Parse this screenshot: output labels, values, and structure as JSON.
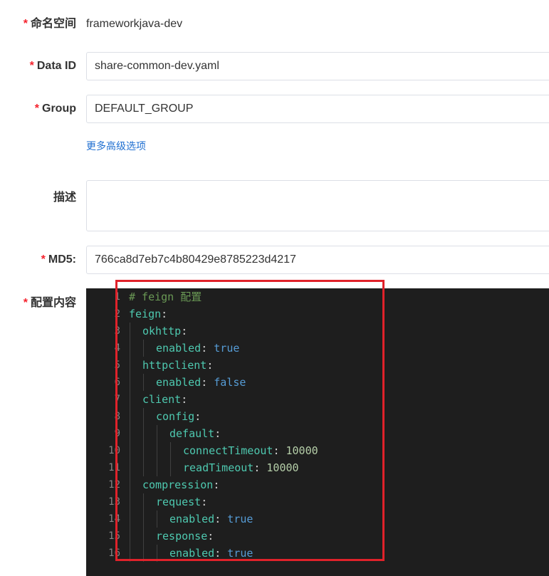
{
  "form": {
    "namespace": {
      "required": "*",
      "label": "命名空间",
      "value": "frameworkjava-dev"
    },
    "data_id": {
      "required": "*",
      "label": "Data ID",
      "value": "share-common-dev.yaml"
    },
    "group": {
      "required": "*",
      "label": "Group",
      "value": "DEFAULT_GROUP"
    },
    "advanced_link": "更多高级选项",
    "description": {
      "label": "描述",
      "value": ""
    },
    "md5": {
      "required": "*",
      "label": "MD5:",
      "value": "766ca8d7eb7c4b80429e8785223d4217"
    },
    "content": {
      "required": "*",
      "label": "配置内容"
    }
  },
  "editor": {
    "lines": [
      {
        "n": "1",
        "indent": 0,
        "comment": "# feign 配置"
      },
      {
        "n": "2",
        "indent": 0,
        "key": "feign"
      },
      {
        "n": "3",
        "indent": 1,
        "key": "okhttp"
      },
      {
        "n": "4",
        "indent": 2,
        "key": "enabled",
        "value": "true",
        "vtype": "bool"
      },
      {
        "n": "5",
        "indent": 1,
        "key": "httpclient"
      },
      {
        "n": "6",
        "indent": 2,
        "key": "enabled",
        "value": "false",
        "vtype": "bool"
      },
      {
        "n": "7",
        "indent": 1,
        "key": "client"
      },
      {
        "n": "8",
        "indent": 2,
        "key": "config"
      },
      {
        "n": "9",
        "indent": 3,
        "key": "default"
      },
      {
        "n": "10",
        "indent": 4,
        "key": "connectTimeout",
        "value": "10000",
        "vtype": "num"
      },
      {
        "n": "11",
        "indent": 4,
        "key": "readTimeout",
        "value": "10000",
        "vtype": "num"
      },
      {
        "n": "12",
        "indent": 1,
        "key": "compression"
      },
      {
        "n": "13",
        "indent": 2,
        "key": "request"
      },
      {
        "n": "14",
        "indent": 3,
        "key": "enabled",
        "value": "true",
        "vtype": "bool"
      },
      {
        "n": "15",
        "indent": 2,
        "key": "response"
      },
      {
        "n": "16",
        "indent": 3,
        "key": "enabled",
        "value": "true",
        "vtype": "bool"
      }
    ]
  },
  "colors": {
    "required_marker": "#f5222d",
    "link": "#1f6fd1",
    "editor_background": "#1e1e1e",
    "highlight_box": "#e0222a"
  }
}
